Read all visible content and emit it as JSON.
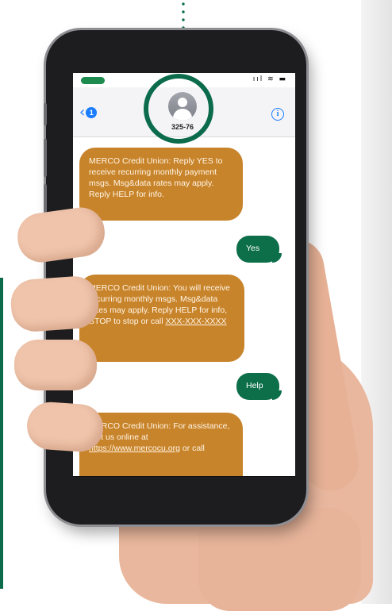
{
  "conversation": {
    "contact_number": "325-76",
    "unread_count": "1",
    "info_icon": "i"
  },
  "status_bar": {
    "icons": "ııl ≋ ▬"
  },
  "messages": [
    {
      "direction": "incoming",
      "text": "MERCO Credit Union: Reply YES to receive recurring monthly payment msgs. Msg&data rates may apply. Reply HELP for info."
    },
    {
      "direction": "outgoing",
      "text": "Yes"
    },
    {
      "direction": "incoming",
      "text": "MERCO Credit Union: You will receive recurring monthly msgs. Msg&data rates may apply. Reply HELP for info, STOP to stop or call ",
      "link": "XXX-XXX-XXXX"
    },
    {
      "direction": "outgoing",
      "text": "Help"
    },
    {
      "direction": "incoming",
      "text": "MERCO Credit Union: For assistance, visit us online at ",
      "link": "https://www.mercocu.org",
      "text_after": " or call"
    }
  ],
  "colors": {
    "incoming_bubble": "#c8842b",
    "outgoing_bubble": "#0d6f4a",
    "accent_green": "#0b6b4b",
    "ios_blue": "#1a7cff"
  },
  "icons": {
    "back": "chevron-left-icon",
    "info": "info-icon",
    "avatar": "person-icon"
  }
}
